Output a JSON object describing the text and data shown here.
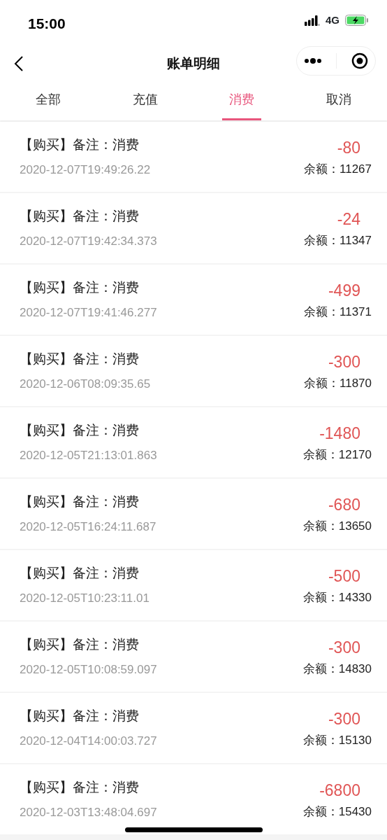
{
  "status_bar": {
    "time": "15:00",
    "network": "4G",
    "charging": true
  },
  "nav": {
    "title": "账单明细"
  },
  "tabs": [
    {
      "label": "全部",
      "selected": false
    },
    {
      "label": "充值",
      "selected": false
    },
    {
      "label": "消费",
      "selected": true
    },
    {
      "label": "取消",
      "selected": false
    }
  ],
  "records": [
    {
      "title": "【购买】备注：消费",
      "time": "2020-12-07T19:49:26.22",
      "amount": "-80",
      "balance": "余额：11267"
    },
    {
      "title": "【购买】备注：消费",
      "time": "2020-12-07T19:42:34.373",
      "amount": "-24",
      "balance": "余额：11347"
    },
    {
      "title": "【购买】备注：消费",
      "time": "2020-12-07T19:41:46.277",
      "amount": "-499",
      "balance": "余额：11371"
    },
    {
      "title": "【购买】备注：消费",
      "time": "2020-12-06T08:09:35.65",
      "amount": "-300",
      "balance": "余额：11870"
    },
    {
      "title": "【购买】备注：消费",
      "time": "2020-12-05T21:13:01.863",
      "amount": "-1480",
      "balance": "余额：12170"
    },
    {
      "title": "【购买】备注：消费",
      "time": "2020-12-05T16:24:11.687",
      "amount": "-680",
      "balance": "余额：13650"
    },
    {
      "title": "【购买】备注：消费",
      "time": "2020-12-05T10:23:11.01",
      "amount": "-500",
      "balance": "余额：14330"
    },
    {
      "title": "【购买】备注：消费",
      "time": "2020-12-05T10:08:59.097",
      "amount": "-300",
      "balance": "余额：14830"
    },
    {
      "title": "【购买】备注：消费",
      "time": "2020-12-04T14:00:03.727",
      "amount": "-300",
      "balance": "余额：15130"
    },
    {
      "title": "【购买】备注：消费",
      "time": "2020-12-03T13:48:04.697",
      "amount": "-6800",
      "balance": "余额：15430"
    }
  ]
}
